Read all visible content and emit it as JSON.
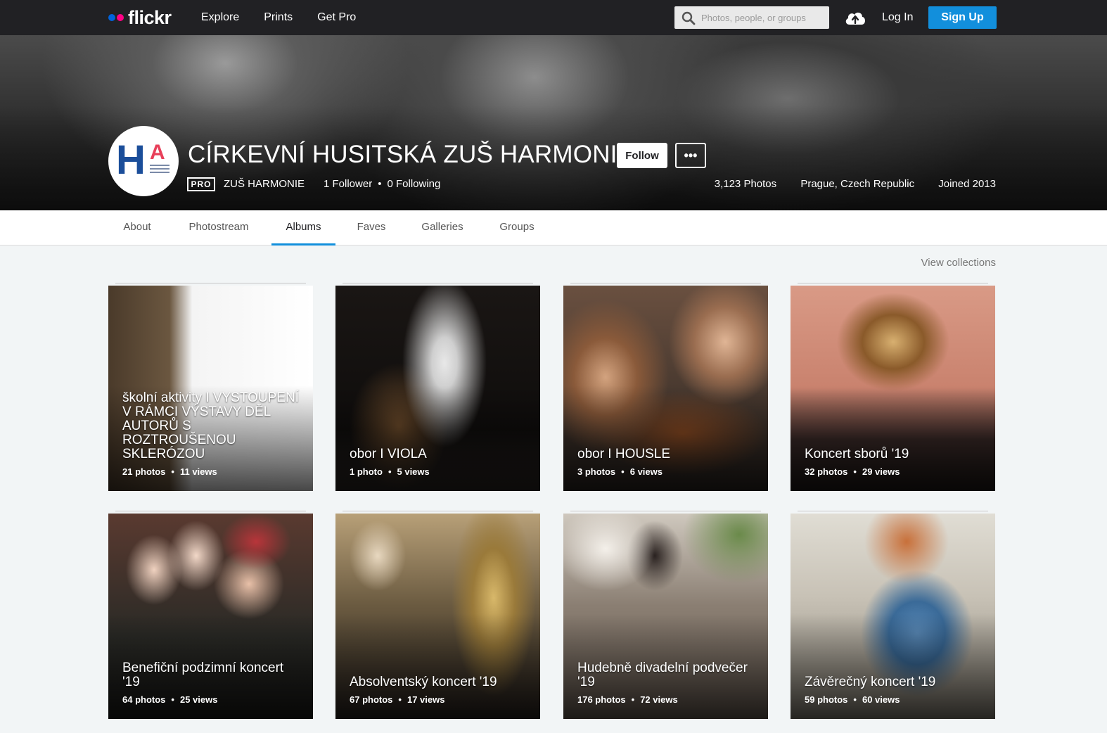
{
  "topnav": {
    "logo_text": "flickr",
    "links": [
      "Explore",
      "Prints",
      "Get Pro"
    ],
    "search_placeholder": "Photos, people, or groups",
    "login": "Log In",
    "signup": "Sign Up"
  },
  "profile": {
    "name": "CÍRKEVNÍ HUSITSKÁ ZUŠ HARMONIE",
    "avatar_text": [
      "H",
      "A"
    ],
    "follow": "Follow",
    "more": "•••",
    "pro_badge": "PRO",
    "username": "ZUŠ HARMONIE",
    "followers": "1 Follower",
    "following": "0 Following",
    "photos": "3,123 Photos",
    "location": "Prague, Czech Republic",
    "joined": "Joined 2013"
  },
  "tabs": [
    "About",
    "Photostream",
    "Albums",
    "Faves",
    "Galleries",
    "Groups"
  ],
  "active_tab": "Albums",
  "view_collections": "View collections",
  "albums": [
    {
      "title": "školní aktivity I VYSTOUPENÍ V RÁMCI VÝSTAVY DĚL AUTORŮ S ROZTROUŠENOU SKLERÓZOU",
      "photos": "21 photos",
      "views": "11 views"
    },
    {
      "title": "obor I VIOLA",
      "photos": "1 photo",
      "views": "5 views"
    },
    {
      "title": "obor I HOUSLE",
      "photos": "3 photos",
      "views": "6 views"
    },
    {
      "title": "Koncert sborů '19",
      "photos": "32 photos",
      "views": "29 views"
    },
    {
      "title": "Benefiční podzimní koncert '19",
      "photos": "64 photos",
      "views": "25 views"
    },
    {
      "title": "Absolventský koncert '19",
      "photos": "67 photos",
      "views": "17 views"
    },
    {
      "title": "Hudebně divadelní podvečer '19",
      "photos": "176 photos",
      "views": "72 views"
    },
    {
      "title": "Závěrečný koncert '19",
      "photos": "59 photos",
      "views": "60 views"
    }
  ],
  "colors": {
    "topbar": "#212124",
    "accent": "#128fdc",
    "flickr_blue": "#0063dc",
    "flickr_pink": "#ff0084"
  }
}
